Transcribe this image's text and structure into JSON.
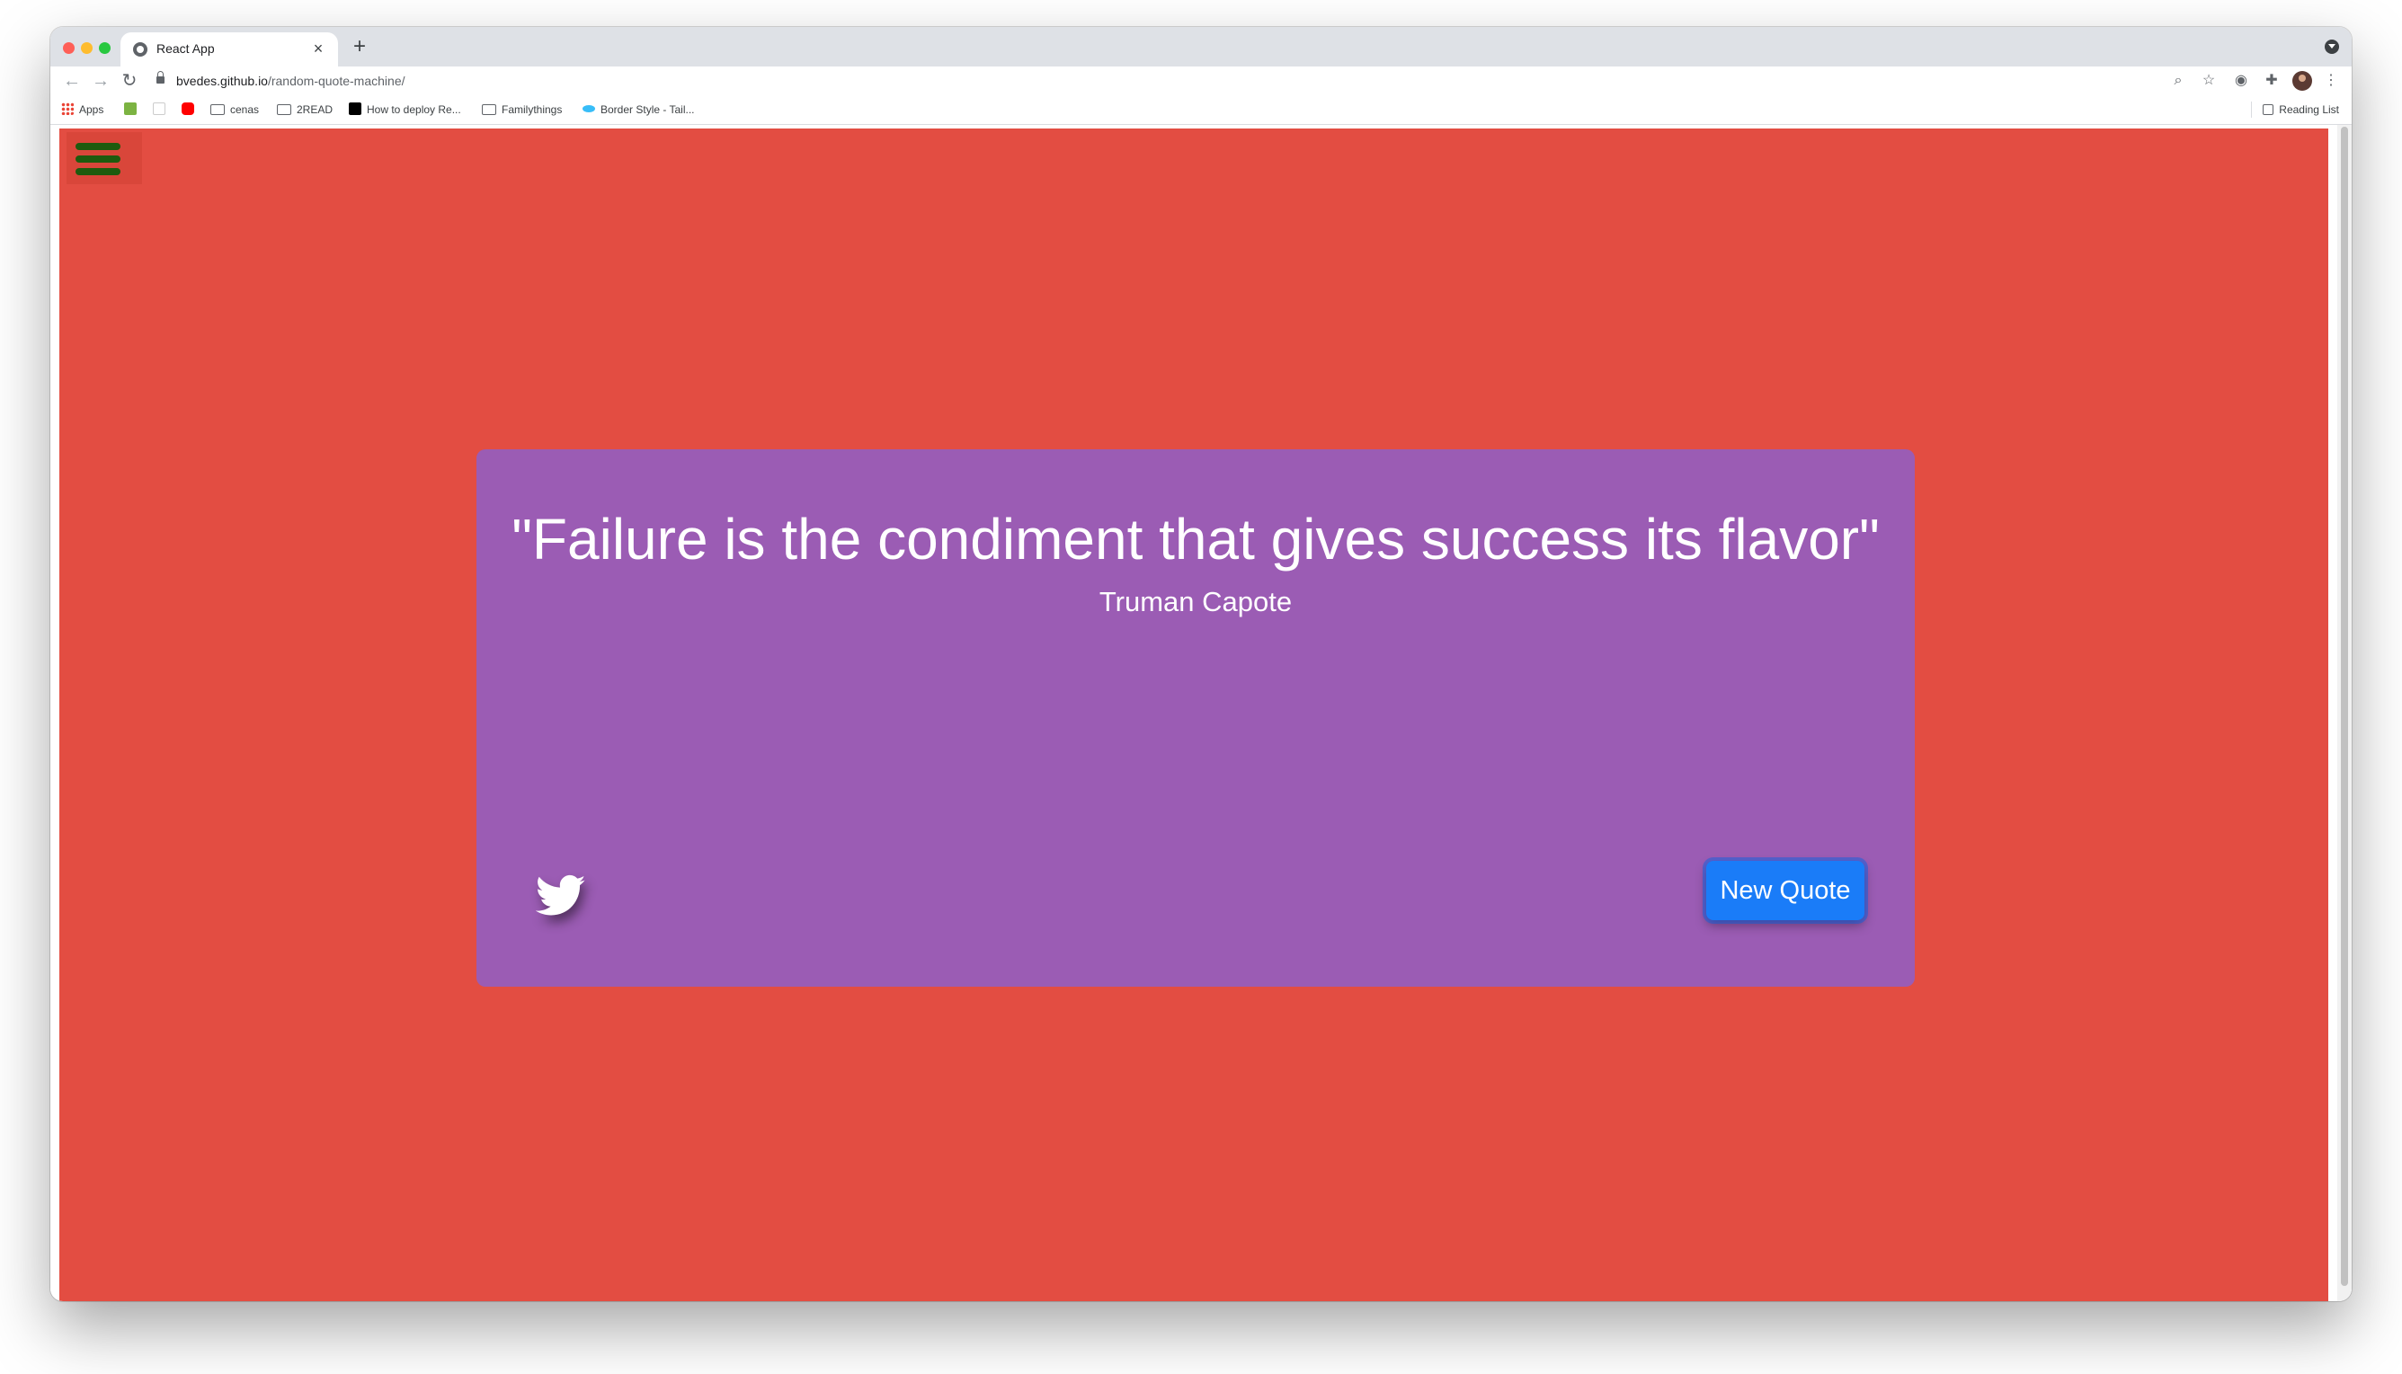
{
  "browser": {
    "tab_title": "React App",
    "tab_close": "×",
    "new_tab": "+",
    "url_host": "bvedes.github.io",
    "url_path": "/random-quote-machine/",
    "bookmarks": [
      {
        "label": "Apps"
      },
      {
        "label": ""
      },
      {
        "label": ""
      },
      {
        "label": ""
      },
      {
        "label": "cenas"
      },
      {
        "label": "2READ"
      },
      {
        "label": "How to deploy Re..."
      },
      {
        "label": "Familythings"
      },
      {
        "label": "Border Style - Tail..."
      }
    ],
    "reading_list": "Reading List"
  },
  "app": {
    "quote": "\"Failure is the condiment that gives success its flavor\"",
    "author": "Truman Capote",
    "new_quote_label": "New Quote",
    "colors": {
      "background": "#e34d42",
      "card": "#9b5cb4",
      "button": "#1a7cf8",
      "menu_icon": "#1e5b0e"
    }
  }
}
